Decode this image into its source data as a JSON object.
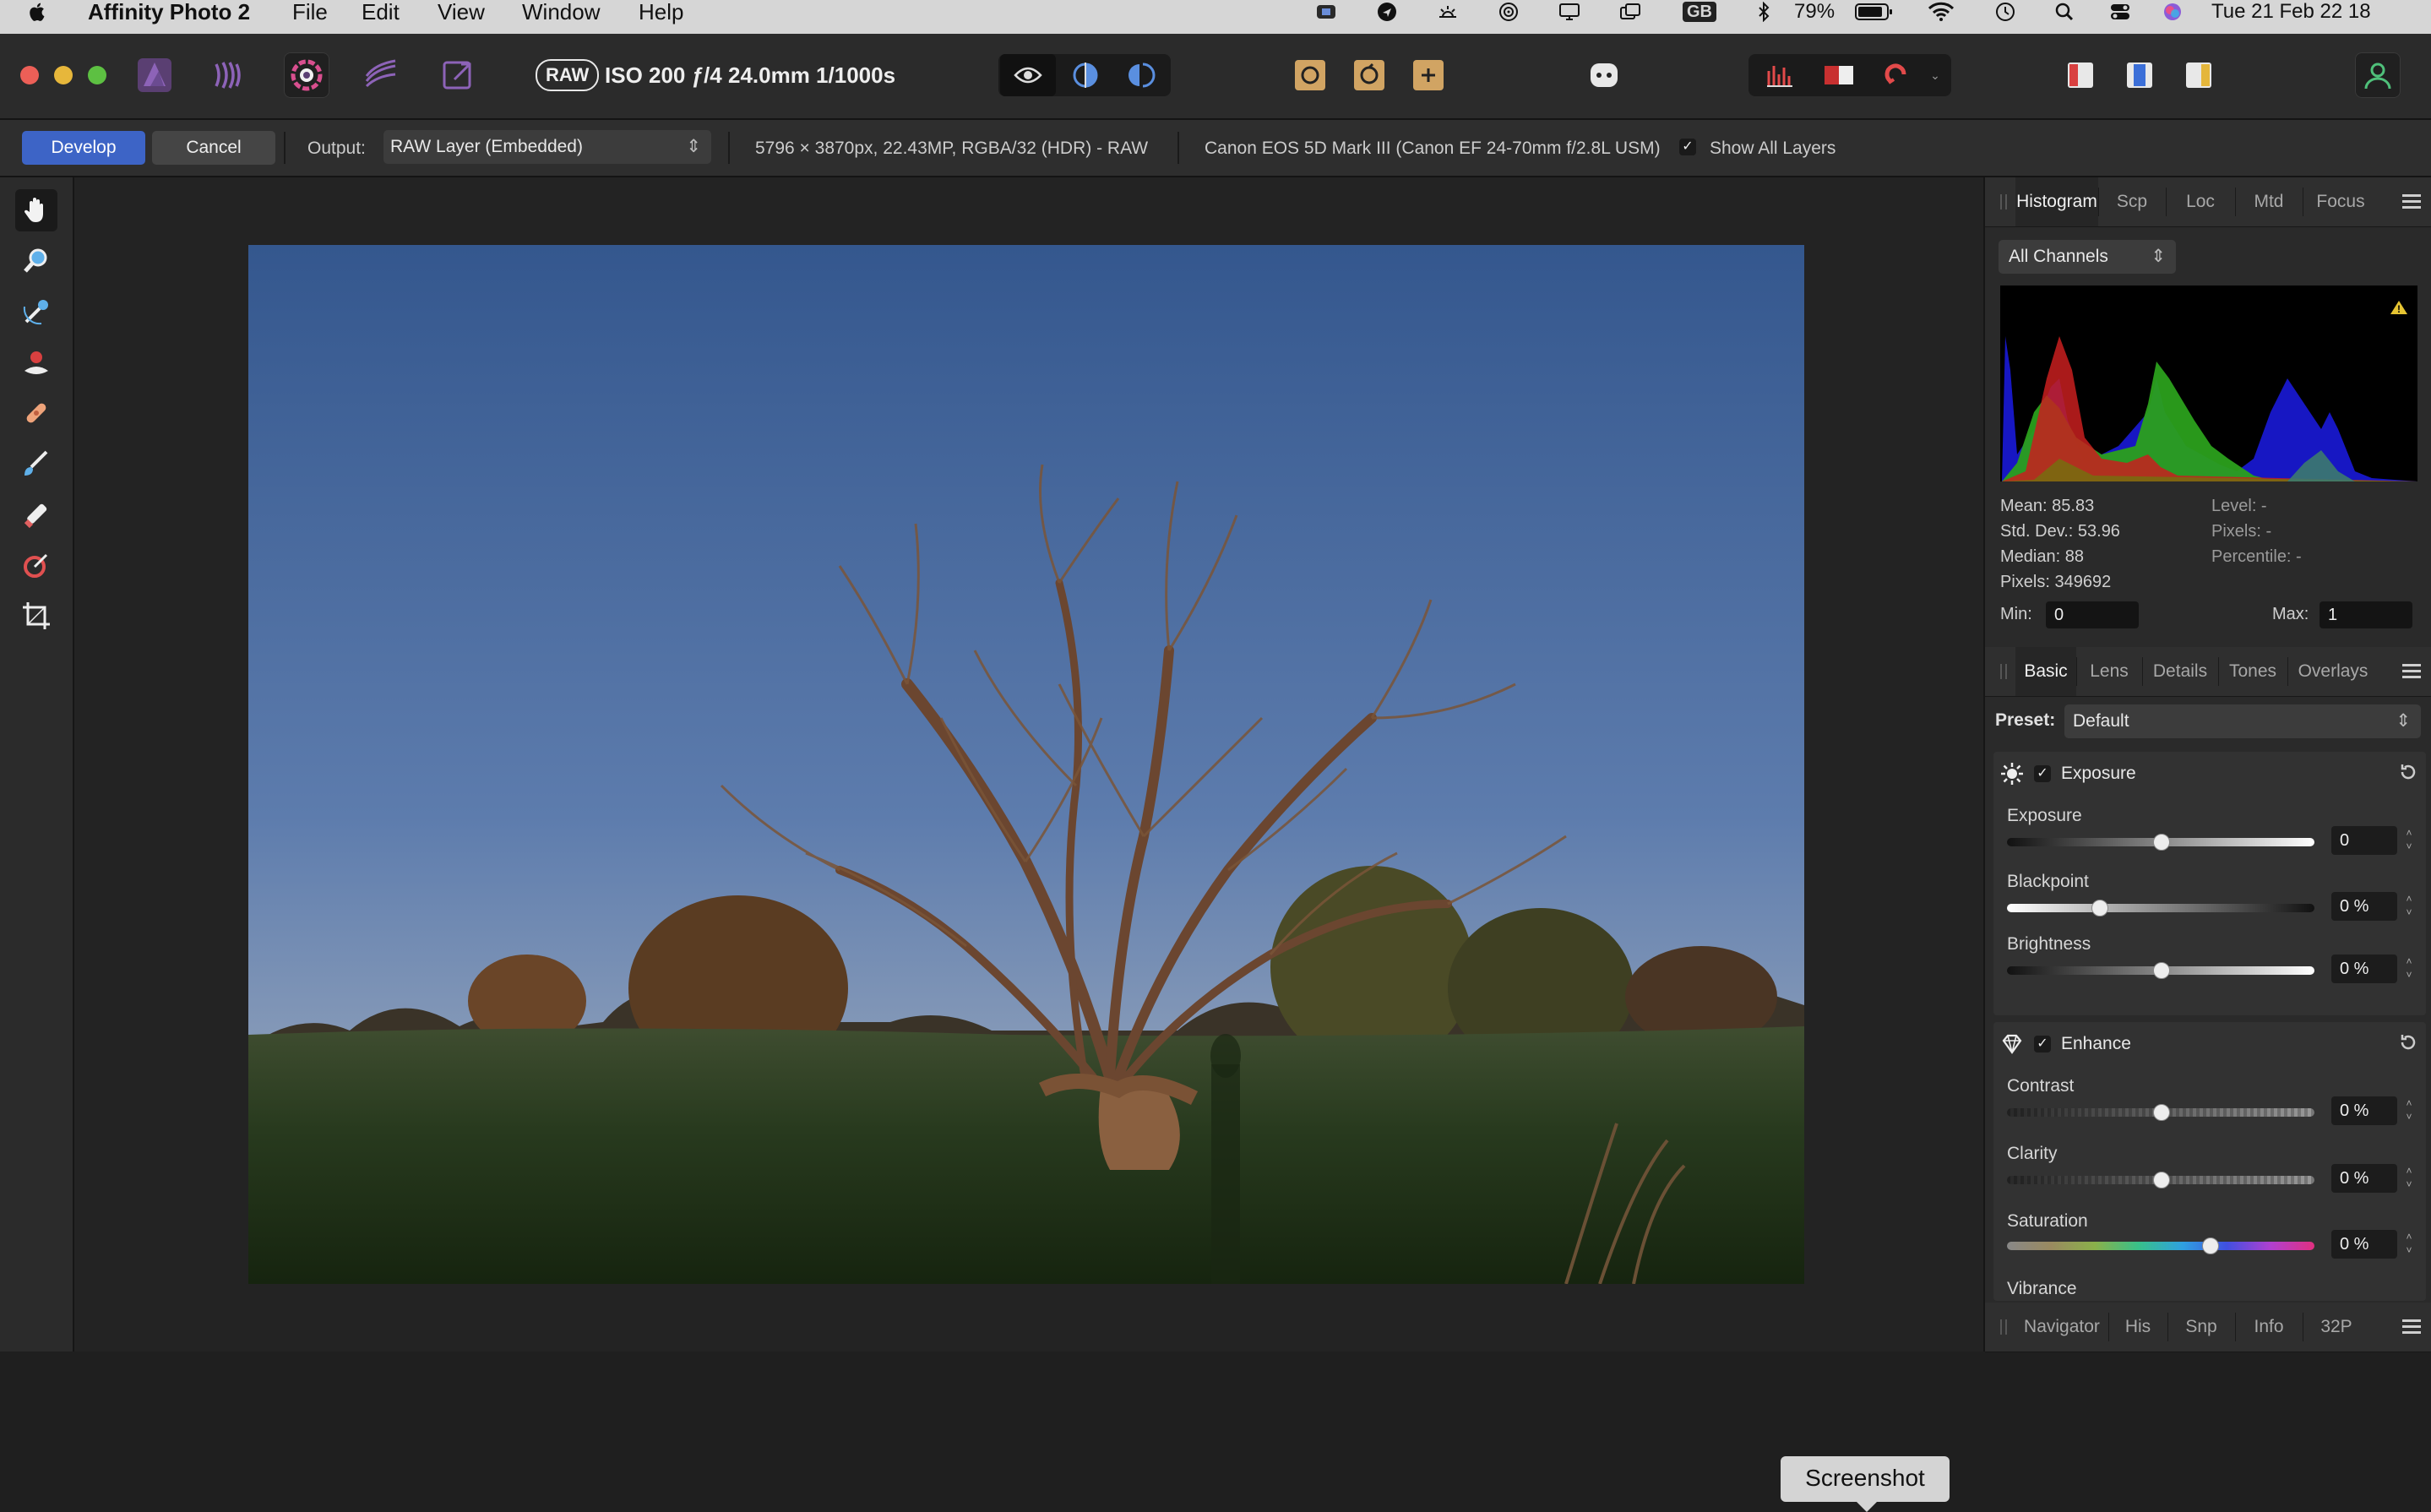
{
  "menubar": {
    "app_name": "Affinity Photo 2",
    "menus": [
      "File",
      "Edit",
      "View",
      "Window",
      "Help"
    ],
    "input_source": "GB",
    "battery": "79%",
    "datetime": "Tue 21 Feb  22 18"
  },
  "toolbar": {
    "raw_badge": "RAW",
    "raw_info": "ISO 200 ƒ/4 24.0mm 1/1000s"
  },
  "contextbar": {
    "develop_label": "Develop",
    "cancel_label": "Cancel",
    "output_label": "Output:",
    "output_value": "RAW Layer (Embedded)",
    "image_info": "5796 × 3870px, 22.43MP, RGBA/32 (HDR) - RAW",
    "camera_info": "Canon EOS 5D Mark III (Canon EF 24-70mm f/2.8L USM)",
    "show_all_layers_label": "Show All Layers",
    "show_all_layers_checked": true
  },
  "tooltip": "Screenshot",
  "histogram_panel": {
    "tabs": [
      "Histogram",
      "Scp",
      "Loc",
      "Mtd",
      "Focus"
    ],
    "active_tab": "Histogram",
    "channel": "All Channels",
    "stats_left": [
      "Mean: 85.83",
      "Std. Dev.: 53.96",
      "Median: 88",
      "Pixels: 349692"
    ],
    "stats_right": [
      "Level: -",
      "Pixels: -",
      "Percentile: -"
    ],
    "min_label": "Min:",
    "min_value": "0",
    "max_label": "Max:",
    "max_value": "1"
  },
  "develop_panel": {
    "tabs": [
      "Basic",
      "Lens",
      "Details",
      "Tones",
      "Overlays"
    ],
    "active_tab": "Basic",
    "preset_label": "Preset:",
    "preset_value": "Default",
    "exposure_section": {
      "title": "Exposure",
      "checked": true,
      "sliders": [
        {
          "label": "Exposure",
          "value": "0",
          "knob": 0.5
        },
        {
          "label": "Blackpoint",
          "value": "0 %",
          "knob": 0.3
        },
        {
          "label": "Brightness",
          "value": "0 %",
          "knob": 0.5
        }
      ]
    },
    "enhance_section": {
      "title": "Enhance",
      "checked": true,
      "sliders": [
        {
          "label": "Contrast",
          "value": "0 %",
          "knob": 0.5
        },
        {
          "label": "Clarity",
          "value": "0 %",
          "knob": 0.5
        },
        {
          "label": "Saturation",
          "value": "0 %",
          "knob": 0.66
        }
      ],
      "partial_label": "Vibrance"
    }
  },
  "bottom_panel": {
    "tabs": [
      "Navigator",
      "His",
      "Snp",
      "Info",
      "32P"
    ]
  },
  "colors": {
    "accent": "#3d64c6",
    "panel": "#2a2a2a",
    "canvas": "#232323"
  }
}
